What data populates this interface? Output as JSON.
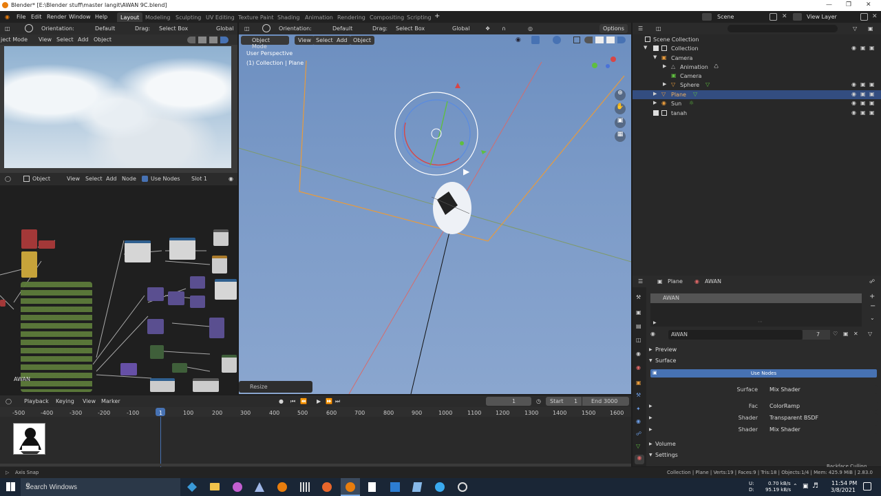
{
  "titlebar": {
    "title": "Blender* [E:\\Blender stuff\\master langit\\AWAN 9C.blend]"
  },
  "menubar": {
    "menus": [
      "File",
      "Edit",
      "Render",
      "Window",
      "Help"
    ],
    "workspaces": [
      "Layout",
      "Modeling",
      "Sculpting",
      "UV Editing",
      "Texture Paint",
      "Shading",
      "Animation",
      "Rendering",
      "Compositing",
      "Scripting"
    ],
    "plus": "+",
    "scene": "Scene",
    "view_layer": "View Layer"
  },
  "left_top_header": {
    "orientation_label": "Orientation:",
    "orientation_value": "Default",
    "drag_label": "Drag:",
    "drag_value": "Select Box",
    "global": "Global"
  },
  "left_viewport_header": {
    "mode": "ject Mode",
    "view": "View",
    "select": "Select",
    "add": "Add",
    "object": "Object"
  },
  "node_header": {
    "object": "Object",
    "view": "View",
    "select": "Select",
    "add": "Add",
    "node": "Node",
    "use_nodes": "Use Nodes",
    "slot": "Slot 1"
  },
  "node_editor": {
    "label": "AWAN"
  },
  "main_header": {
    "orientation_label": "Orientation:",
    "orientation_value": "Default",
    "drag_label": "Drag:",
    "drag_value": "Select Box",
    "global": "Global",
    "options": "Options"
  },
  "main_viewport_header": {
    "mode": "Object Mode",
    "view": "View",
    "select": "Select",
    "add": "Add",
    "object": "Object"
  },
  "viewport": {
    "perspective": "User Perspective",
    "collection": "(1) Collection | Plane",
    "operator": "Resize"
  },
  "outliner": {
    "rows": [
      {
        "label": "Scene Collection",
        "indent": 0
      },
      {
        "label": "Collection",
        "indent": 1
      },
      {
        "label": "Camera",
        "indent": 2
      },
      {
        "label": "Animation",
        "indent": 3
      },
      {
        "label": "Camera",
        "indent": 3
      },
      {
        "label": "Sphere",
        "indent": 3
      },
      {
        "label": "Plane",
        "indent": 2,
        "selected": true
      },
      {
        "label": "Sun",
        "indent": 2
      },
      {
        "label": "tanah",
        "indent": 1
      }
    ]
  },
  "properties": {
    "object": "Plane",
    "material": "AWAN",
    "slot_name": "AWAN",
    "mat_field": "AWAN",
    "users": "7",
    "preview": "Preview",
    "surface_section": "Surface",
    "use_nodes": "Use Nodes",
    "rows": [
      {
        "label": "Surface",
        "value": "Mix Shader"
      },
      {
        "label": "Fac",
        "value": "ColorRamp"
      },
      {
        "label": "Shader",
        "value": "Transparent BSDF"
      },
      {
        "label": "Shader",
        "value": "Mix Shader"
      }
    ],
    "volume": "Volume",
    "settings": "Settings",
    "cut": "Backface Culling"
  },
  "timeline": {
    "playback": "Playback",
    "keying": "Keying",
    "view": "View",
    "marker": "Marker",
    "frame": "1",
    "start_label": "Start",
    "start": "1",
    "end_label": "End",
    "end": "3000",
    "ticks": [
      "-500",
      "-400",
      "-300",
      "-200",
      "-100",
      "1",
      "100",
      "200",
      "300",
      "400",
      "500",
      "600",
      "700",
      "800",
      "900",
      "1000",
      "1100",
      "1200",
      "1300",
      "1400",
      "1500",
      "1600"
    ]
  },
  "statusbar": {
    "left": "Axis Snap",
    "right": "Collection | Plane | Verts:19 | Faces:9 | Tris:18 | Objects:1/4 | Mem: 425.9 MiB | 2.83.0"
  },
  "taskbar": {
    "search": "Search Windows",
    "net_up": "0.70 kB/s",
    "net_down": "95.19 kB/s",
    "net_u": "U:",
    "net_d": "D:",
    "time": "11:54 PM",
    "date": "3/8/2021"
  },
  "colors": {
    "accent": "#4772b3",
    "selected": "#334d80",
    "orange": "#e89b3c"
  }
}
